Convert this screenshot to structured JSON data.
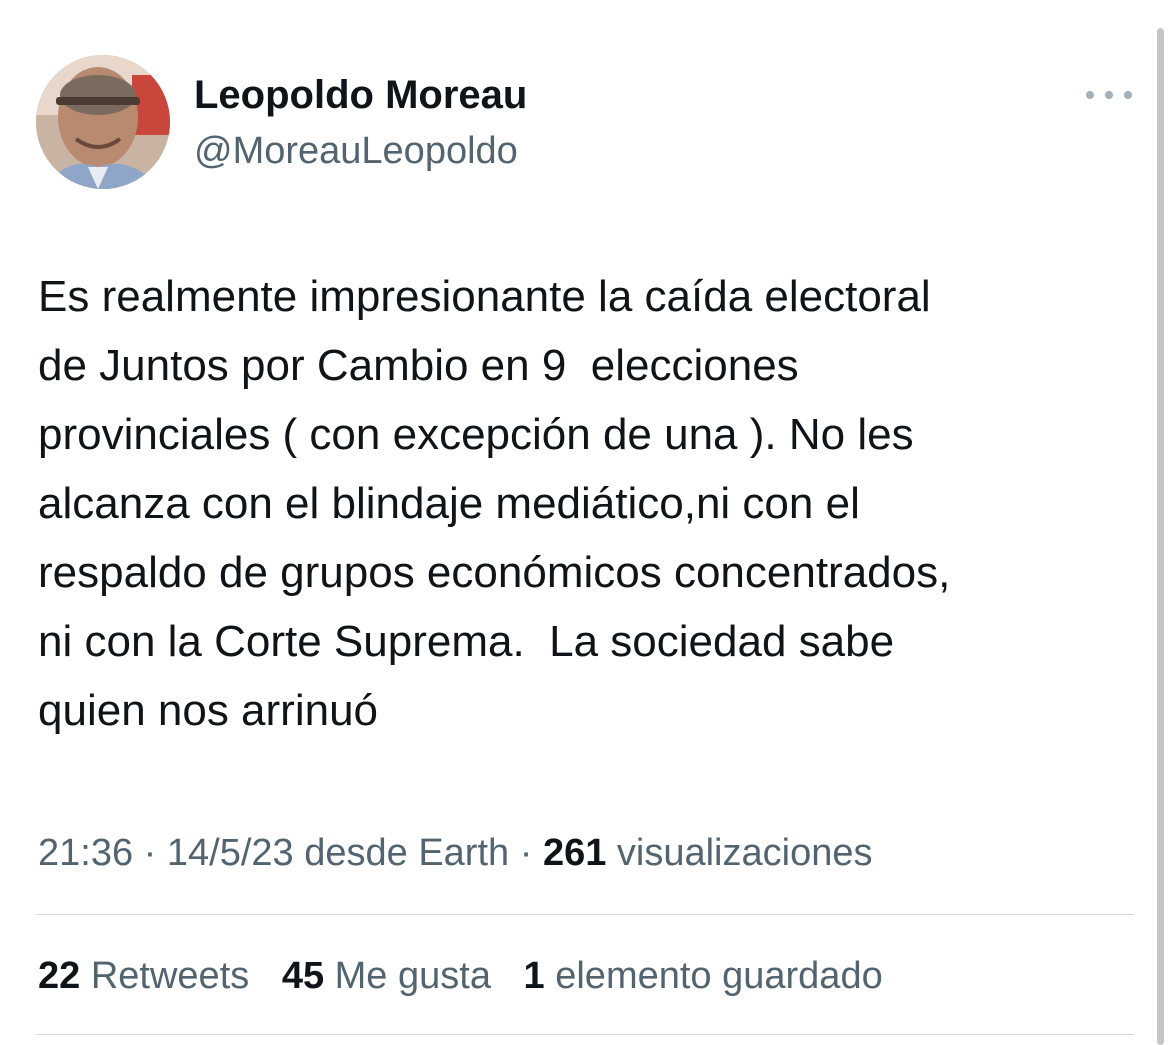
{
  "author": {
    "display_name": "Leopoldo Moreau",
    "handle": "@MoreauLeopoldo",
    "avatar_icon": "avatar-photo"
  },
  "more_icon": "ellipsis-icon",
  "tweet": {
    "text": "Es realmente impresionante la caída electoral\nde Juntos por Cambio en 9  elecciones\nprovinciales ( con excepción de una ). No les\nalcanza con el blindaje mediático,ni con el\nrespaldo de grupos económicos concentrados,\nni con la Corte Suprema.  La sociedad sabe\nquien nos arrinuó"
  },
  "meta": {
    "time": "21:36",
    "separator": "·",
    "date": "14/5/23",
    "source": "desde Earth",
    "views_count": "261",
    "views_label": "visualizaciones"
  },
  "stats": {
    "retweets_count": "22",
    "retweets_label": "Retweets",
    "likes_count": "45",
    "likes_label": "Me gusta",
    "bookmarks_count": "1",
    "bookmarks_label": "elemento guardado"
  },
  "colors": {
    "primary_text": "#0f1419",
    "secondary_text": "#536471",
    "divider": "#cfd9de"
  }
}
